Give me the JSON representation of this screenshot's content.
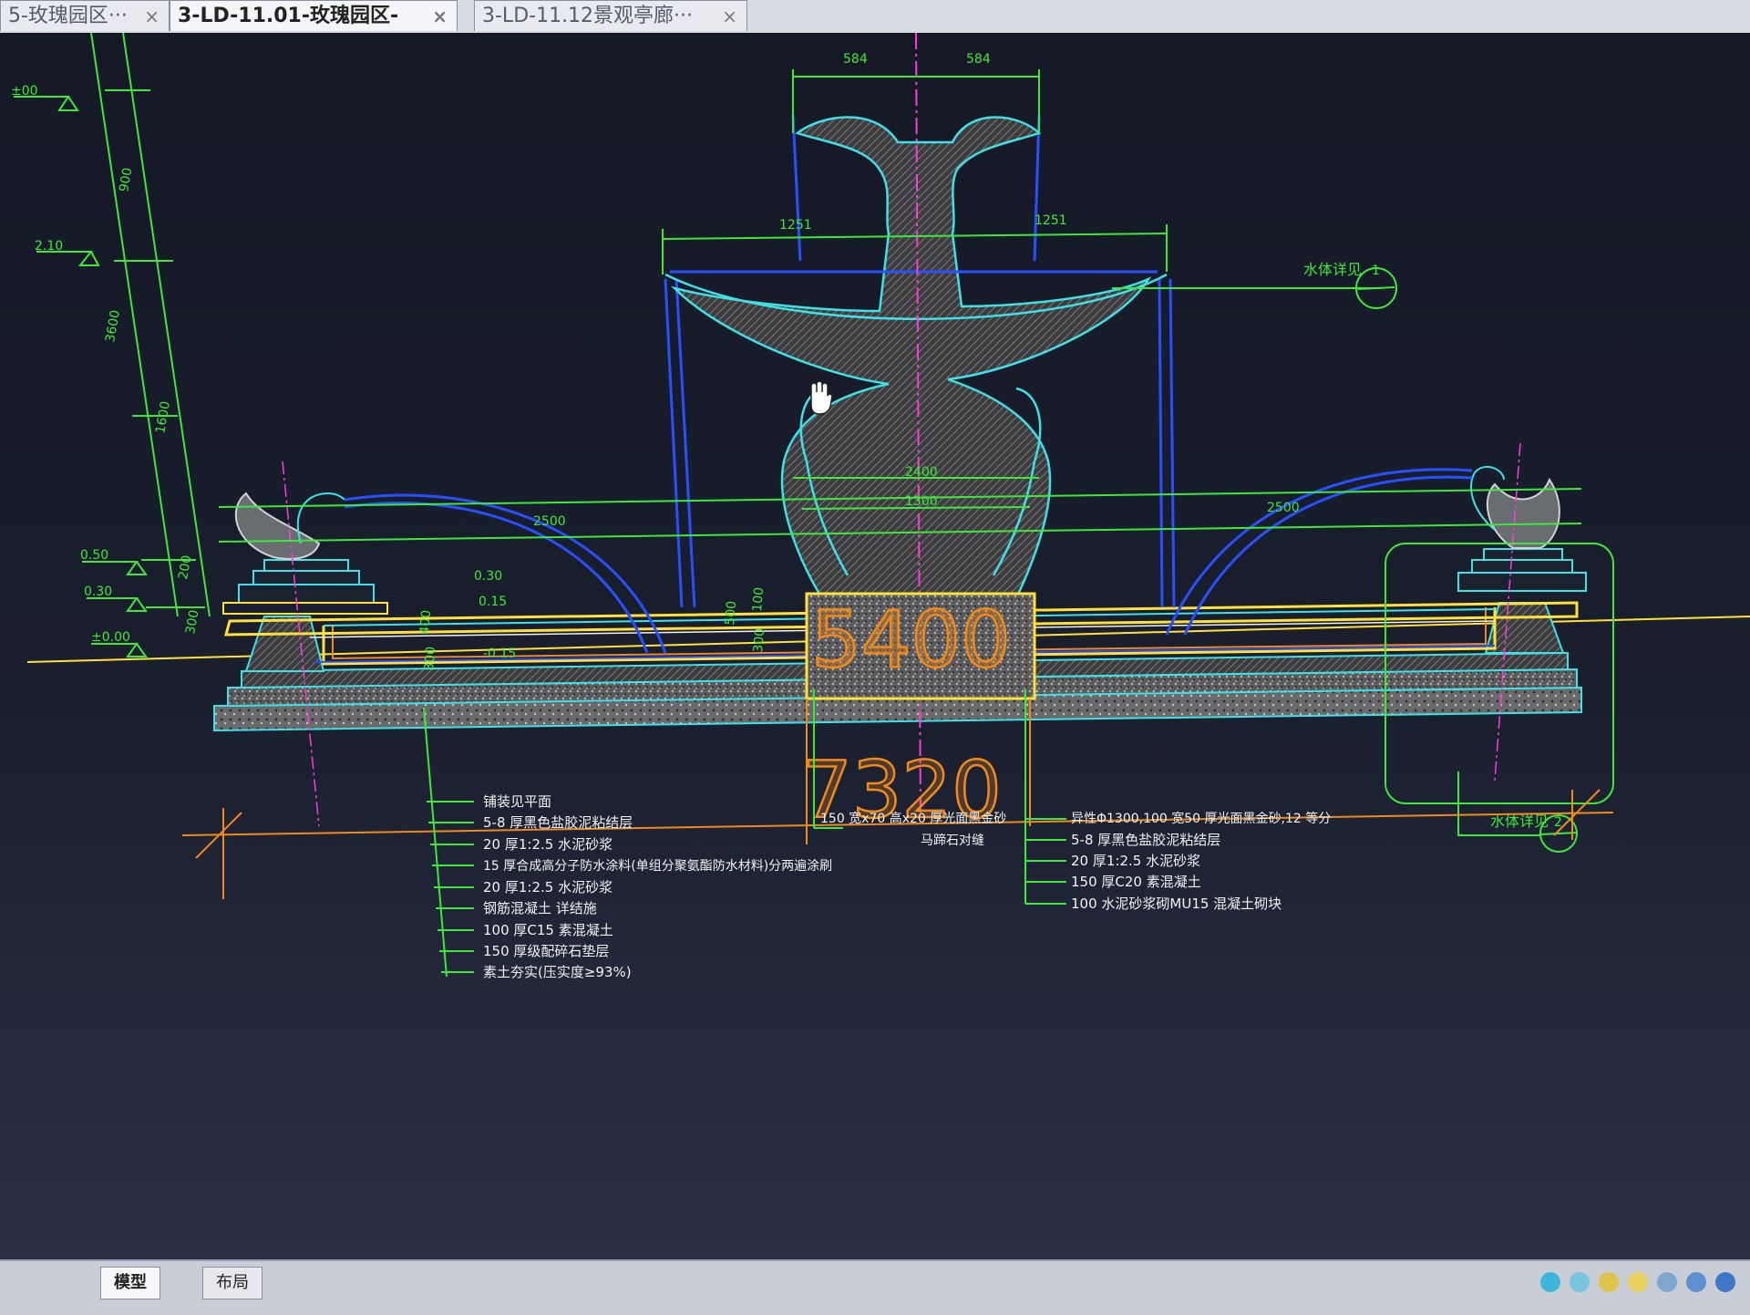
{
  "tabs": [
    {
      "label": "5-玫瑰园区···",
      "active": false,
      "close": "×"
    },
    {
      "label": "3-LD-11.01-玫瑰园区-",
      "active": true,
      "close": "×"
    },
    {
      "label": "3-LD-11.12景观亭廊···",
      "active": false,
      "close": "×"
    }
  ],
  "drawing": {
    "elevations": [
      "±00",
      "2.10",
      "0.50",
      "0.30",
      "±0.00"
    ],
    "left_dims": [
      "900",
      "3600",
      "1600",
      "200",
      "300"
    ],
    "top_dims": [
      "584",
      "584"
    ],
    "bowl_dims": [
      "1251",
      "1251"
    ],
    "spread_dims": [
      "2500",
      "2500"
    ],
    "center_dims": [
      "2400",
      "1300"
    ],
    "pool_levels": [
      "0.30",
      "0.15",
      "-0.15"
    ],
    "pool_dims": [
      "400",
      "300",
      "500",
      "100",
      "300"
    ],
    "big_dims": [
      "5400",
      "7320"
    ],
    "detail_callouts": [
      {
        "label": "水体详见",
        "num": "1"
      },
      {
        "label": "水体详见",
        "num": "2"
      }
    ],
    "notes_left": [
      "铺装见平面",
      "5-8  厚黑色盐胶泥粘结层",
      "20  厚1:2.5  水泥砂浆",
      "15  厚合成高分子防水涂料(单组分聚氨酯防水材料)分两遍涂刷",
      "20  厚1:2.5  水泥砂浆",
      "钢筋混凝土 详结施",
      "100  厚C15  素混凝土",
      "150  厚级配碎石垫层",
      "素土夯实(压实度≥93%)"
    ],
    "notes_middle": [
      "150  宽x70  高x20  厚光面黑金砂",
      "马蹄石对缝"
    ],
    "notes_right": [
      "异性Φ1300,100    宽50  厚光面黑金砂,12  等分",
      "5-8  厚黑色盐胶泥粘结层",
      "20  厚1:2.5  水泥砂浆",
      "150  厚C20  素混凝土",
      "100  水泥砂浆砌MU15  混凝土砌块"
    ]
  },
  "bottom": {
    "tabs": [
      {
        "label": "模型",
        "active": true
      },
      {
        "label": "布局",
        "active": false
      }
    ]
  },
  "colors": {
    "cyan": "#3fe0e6",
    "green": "#3ee83a",
    "yellow": "#ffe13a",
    "orange": "#f08a1c",
    "blue": "#2850ff",
    "magenta": "#ff3ad9",
    "white": "#f2f2f2"
  }
}
